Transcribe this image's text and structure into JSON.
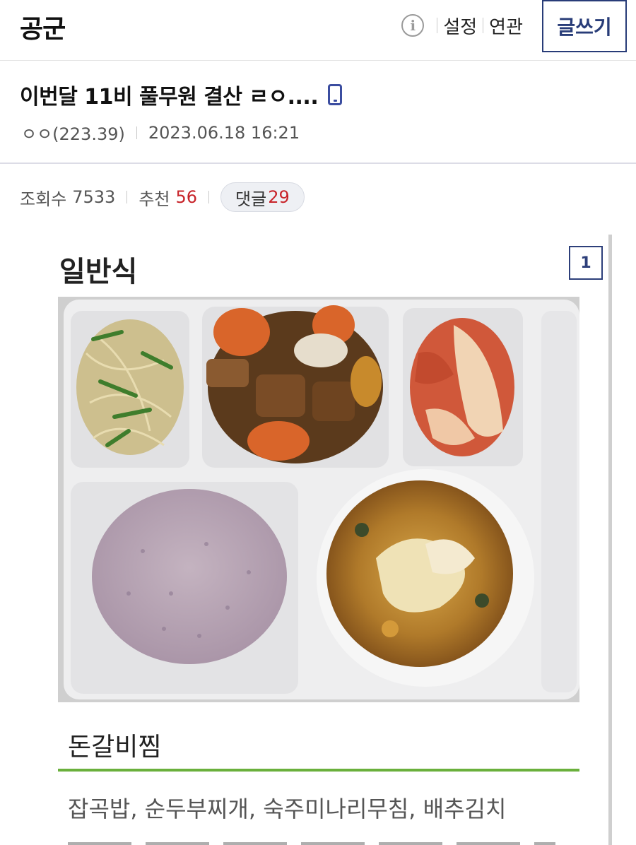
{
  "header": {
    "gallery_name": "공군",
    "settings_label": "설정",
    "related_label": "연관",
    "write_label": "글쓰기",
    "info_icon_char": "i"
  },
  "post": {
    "title": "이번달 11비 풀무원 결산 ㄹㅇ....",
    "author": "ㅇㅇ(223.39)",
    "datetime": "2023.06.18 16:21"
  },
  "stats": {
    "views_label": "조회수",
    "views": "7533",
    "recommend_label": "추천",
    "recommend": "56",
    "comments_label": "댓글",
    "comments": "29"
  },
  "card": {
    "heading": "일반식",
    "page_number": "1",
    "photo_alt": "meal tray photo",
    "menu_name": "돈갈비찜",
    "side_dishes": "잡곡밥, 순두부찌개, 숙주미나리무침, 배추김치"
  },
  "colors": {
    "accent_navy": "#283c78",
    "accent_red": "#c8242a",
    "rule_green": "#6ab03c"
  }
}
